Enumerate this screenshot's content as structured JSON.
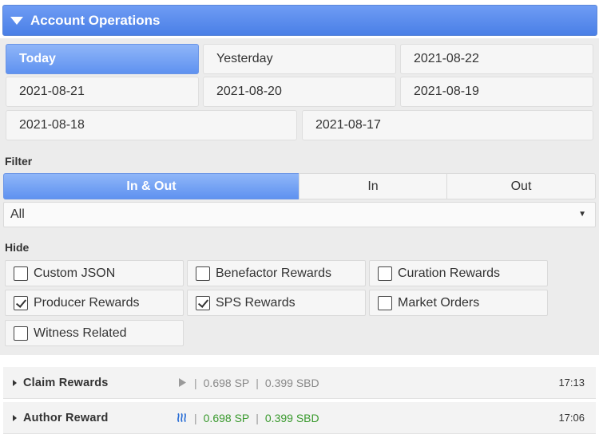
{
  "header": {
    "title": "Account Operations"
  },
  "days": [
    "Today",
    "Yesterday",
    "2021-08-22",
    "2021-08-21",
    "2021-08-20",
    "2021-08-19",
    "2021-08-18",
    "2021-08-17"
  ],
  "filter": {
    "label": "Filter",
    "segments": [
      "In & Out",
      "In",
      "Out"
    ],
    "select_value": "All"
  },
  "hide": {
    "label": "Hide",
    "options": [
      {
        "label": "Custom JSON",
        "checked": false
      },
      {
        "label": "Benefactor Rewards",
        "checked": false
      },
      {
        "label": "Curation Rewards",
        "checked": false
      },
      {
        "label": "Producer Rewards",
        "checked": true
      },
      {
        "label": "SPS Rewards",
        "checked": true
      },
      {
        "label": "Market Orders",
        "checked": false
      },
      {
        "label": "Witness Related",
        "checked": false
      }
    ]
  },
  "operations": [
    {
      "name": "Claim Rewards",
      "icon": "play-icon",
      "sp": "0.698 SP",
      "sbd": "0.399 SBD",
      "time": "17:13"
    },
    {
      "name": "Author Reward",
      "icon": "steem-logo-icon",
      "sp": "0.698 SP",
      "sbd": "0.399 SBD",
      "time": "17:06"
    }
  ],
  "colors": {
    "accent": "#5f92f0",
    "panel": "#ececec",
    "green_value": "#3a9a2e"
  }
}
